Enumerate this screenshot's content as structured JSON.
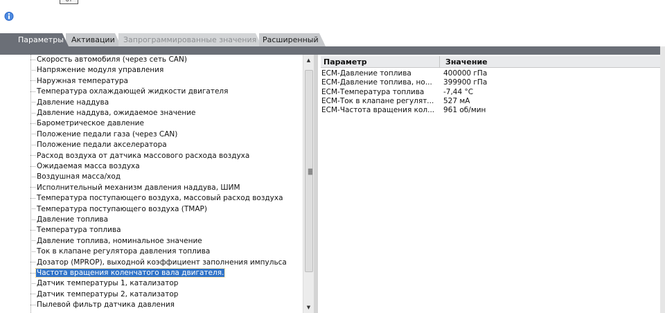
{
  "top_button": {
    "label": "от"
  },
  "tabs": [
    {
      "label": "Параметры",
      "state": "active"
    },
    {
      "label": "Активации",
      "state": "normal"
    },
    {
      "label": "Запрограммированные значения",
      "state": "disabled"
    },
    {
      "label": "Расширенный",
      "state": "normal"
    }
  ],
  "tree": {
    "items": [
      "Скорость автомобиля (через сеть CAN)",
      "Напряжение модуля управления",
      "Наружная температура",
      "Температура охлаждающей жидкости двигателя",
      "Давление наддува",
      "Давление наддува, ожидаемое значение",
      "Барометрическое давление",
      "Положение педали газа (через CAN)",
      "Положение педали акселератора",
      "Расход воздуха от датчика массового расхода воздуха",
      "Ожидаемая масса воздуха",
      "Воздушная масса/ход",
      "Исполнительный механизм давления наддува, ШИМ",
      "Температура поступающего воздуха, массовый расход воздуха",
      "Температура поступающего воздуха (TMAP)",
      "Давление топлива",
      "Температура топлива",
      "Давление топлива, номинальное значение",
      "Ток в клапане регулятора давления топлива",
      "Дозатор (MPROP), выходной коэффициент заполнения импульса",
      "Частота вращения коленчатого вала двигателя.",
      "Датчик температуры 1, катализатор",
      "Датчик температуры 2, катализатор",
      "Пылевой фильтр датчика давления"
    ],
    "selected_index": 20
  },
  "grid": {
    "headers": {
      "param": "Параметр",
      "value": "Значение"
    },
    "rows": [
      {
        "param": "ECM-Давление топлива",
        "value": "400000 гПа"
      },
      {
        "param": "ECM-Давление топлива, но...",
        "value": "399900 гПа"
      },
      {
        "param": "ECM-Температура топлива",
        "value": "-7,44 °C"
      },
      {
        "param": "ECM-Ток в клапане регулят...",
        "value": "527 мА"
      },
      {
        "param": "ECM-Частота вращения кол...",
        "value": "961 об/мин"
      }
    ]
  },
  "colors": {
    "active_tab": "#6b6f77",
    "selection": "#3073c8",
    "info_icon": "#2a66c9"
  },
  "icons": {
    "info": "info-icon",
    "scroll_up": "arrow-up-icon",
    "scroll_down": "arrow-down-icon"
  }
}
